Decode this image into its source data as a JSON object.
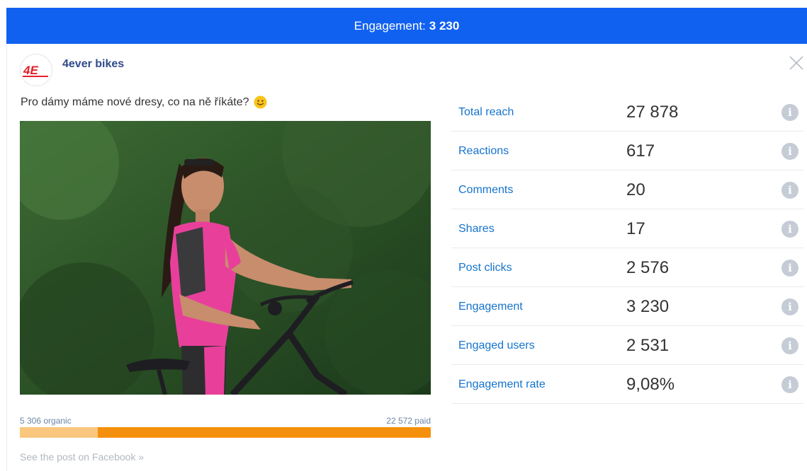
{
  "header": {
    "label": "Engagement:",
    "value": "3 230",
    "background": "#1161f1"
  },
  "post": {
    "page_name": "4ever bikes",
    "logo_text": "4E",
    "text": "Pro dámy máme nové dresy, co na ně říkáte?",
    "emoji": "smiley-emoji",
    "image": "woman-in-pink-cycling-jersey-with-mountain-bike",
    "close_icon": "close-icon"
  },
  "reach": {
    "organic_label": "5 306 organic",
    "paid_label": "22 572 paid",
    "organic_value": 5306,
    "paid_value": 22572,
    "organic_fraction": 0.19,
    "organic_color": "#f9c77e",
    "paid_color": "#f5900c"
  },
  "see_post_link": "See the post on Facebook »",
  "metrics": [
    {
      "label": "Total reach",
      "value": "27 878"
    },
    {
      "label": "Reactions",
      "value": "617"
    },
    {
      "label": "Comments",
      "value": "20"
    },
    {
      "label": "Shares",
      "value": "17"
    },
    {
      "label": "Post clicks",
      "value": "2 576"
    },
    {
      "label": "Engagement",
      "value": "3 230"
    },
    {
      "label": "Engaged users",
      "value": "2 531"
    },
    {
      "label": "Engagement rate",
      "value": "9,08%"
    }
  ],
  "colors": {
    "metric_label": "#1574cc",
    "page_name": "#2f4b8a",
    "info_icon": "#c5ccd6"
  }
}
